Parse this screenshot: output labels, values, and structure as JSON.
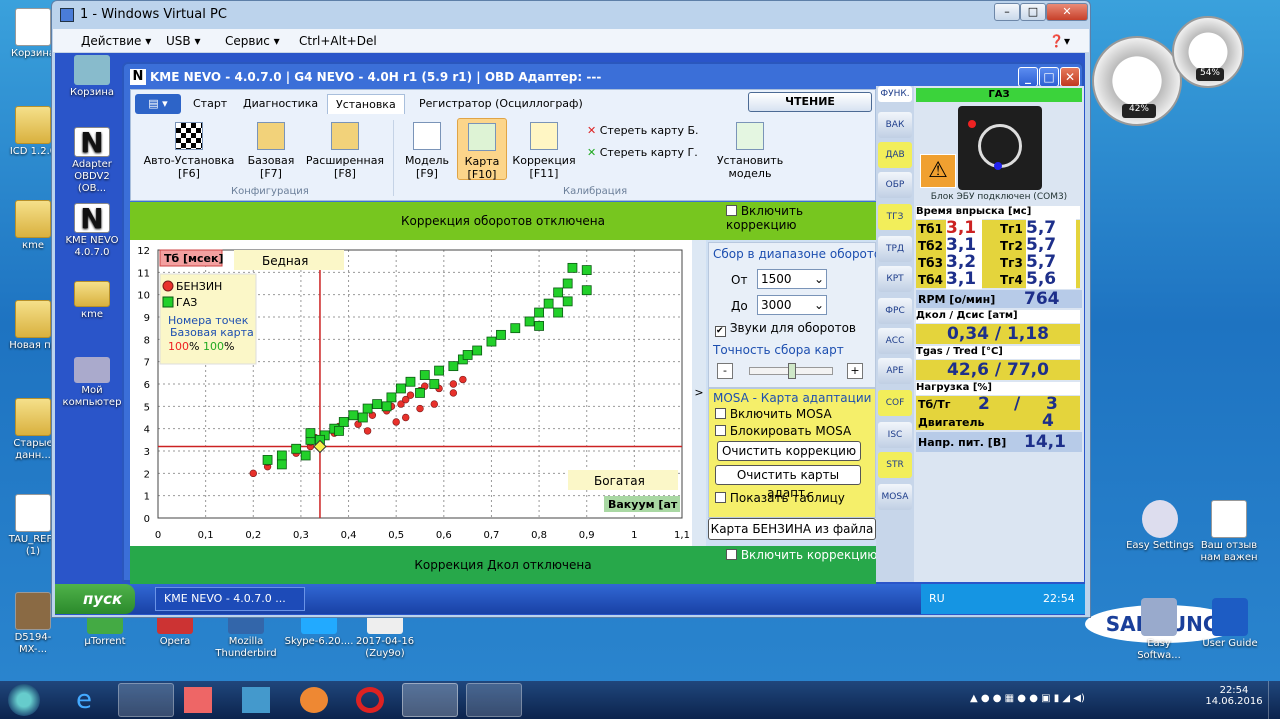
{
  "host_desktop": {
    "icons": [
      "Корзина",
      "ICD 1.2.0",
      "кme",
      "Новая па",
      "Старые данн...",
      "TAU_REF_ (1)",
      "D5194-MX-...",
      "µTorrent",
      "Opera",
      "Mozilla Thunderbird",
      "Skype-6.20....",
      "2017-04-16 (Zuy9o)",
      "Easy Settings",
      "Ваш отзыв нам важен",
      "Easy Softwa...",
      "User Guide"
    ]
  },
  "gadgets": {
    "cpu": "42%",
    "mem": "54%"
  },
  "vpc": {
    "title": "1 - Windows Virtual PC",
    "menu": [
      "Действие ▾",
      "USB ▾",
      "Сервис ▾",
      "Ctrl+Alt+Del"
    ],
    "help": "❓▾"
  },
  "guest_icons": [
    "Корзина",
    "Adapter OBDV2 (OB...",
    "KME NEVO 4.0.7.0",
    "кme",
    "Мой компьютер"
  ],
  "kme": {
    "title": "KME NEVO - 4.0.7.0  |  G4 NEVO - 4.0H r1 (5.9 r1)  |  OBD Адаптер: ---",
    "tabs": [
      "Старт",
      "Диагностика",
      "Установка",
      "Регистратор (Осциллограф)"
    ],
    "read_button": "ЧТЕНИЕ",
    "config_buttons": [
      {
        "l1": "Авто-Установка",
        "l2": "[F6]"
      },
      {
        "l1": "Базовая",
        "l2": "[F7]"
      },
      {
        "l1": "Расширенная",
        "l2": "[F8]"
      }
    ],
    "calib_buttons": [
      {
        "l1": "Модель",
        "l2": "[F9]"
      },
      {
        "l1": "Карта",
        "l2": "[F10]"
      },
      {
        "l1": "Коррекция",
        "l2": "[F11]"
      }
    ],
    "erase_b": "Стереть карту Б.",
    "erase_g": "Стереть карту Г.",
    "set_model": "Установить модель",
    "group_config": "Конфигурация",
    "group_calib": "Калибрация",
    "rpm_corr": "Коррекция оборотов отключена",
    "rpm_corr_cb": "Включить коррекцию",
    "pcol_corr": "Коррекция Дкол отключена",
    "pcol_corr_cb": "Включить коррекцию Д",
    "collect_title": "Сбор в диапазоне оборотов",
    "from_label": "От",
    "from_val": "1500",
    "to_label": "До",
    "to_val": "3000",
    "sounds": "Звуки для оборотов",
    "accuracy": "Точность сбора карт",
    "mosa_title": "MOSA - Карта адаптации",
    "mosa_enable": "Включить MOSA",
    "mosa_block": "Блокировать MOSA",
    "clear_corr": "Очистить коррекцию",
    "clear_maps": "Очистить карты адапт.",
    "show_table": "Показать таблицу",
    "load_map": "Карта БЕНЗИНА из файла"
  },
  "chart_data": {
    "type": "scatter",
    "ylabel_box": "Тб [мсек]",
    "xlabel_box": "Вакуум [ат",
    "lean": "Бедная",
    "rich": "Богатая",
    "legend": [
      "БЕНЗИН",
      "ГАЗ"
    ],
    "legend_note1": "Номера точек",
    "legend_note2": "Базовая карта",
    "pct_red": "100",
    "pct_green": "100",
    "xlim": [
      0,
      1.1
    ],
    "ylim": [
      0,
      12
    ],
    "xticks": [
      "0",
      "0,1",
      "0,2",
      "0,3",
      "0,4",
      "0,5",
      "0,6",
      "0,7",
      "0,8",
      "0,9",
      "1",
      "1,1"
    ],
    "yticks": [
      "0",
      "1",
      "2",
      "3",
      "4",
      "5",
      "6",
      "7",
      "8",
      "9",
      "10",
      "11",
      "12"
    ],
    "crosshair": {
      "x": 0.34,
      "y": 3.2
    },
    "series": [
      {
        "name": "БЕНЗИН",
        "color": "#e8312b",
        "points": [
          [
            0.2,
            2.0
          ],
          [
            0.23,
            2.3
          ],
          [
            0.23,
            2.5
          ],
          [
            0.26,
            2.6
          ],
          [
            0.26,
            2.8
          ],
          [
            0.29,
            2.9
          ],
          [
            0.29,
            3.1
          ],
          [
            0.32,
            3.2
          ],
          [
            0.32,
            3.4
          ],
          [
            0.33,
            3.6
          ],
          [
            0.35,
            3.7
          ],
          [
            0.37,
            3.8
          ],
          [
            0.38,
            4.1
          ],
          [
            0.39,
            4.3
          ],
          [
            0.42,
            4.2
          ],
          [
            0.43,
            4.5
          ],
          [
            0.45,
            4.6
          ],
          [
            0.48,
            4.8
          ],
          [
            0.49,
            5.0
          ],
          [
            0.51,
            5.1
          ],
          [
            0.52,
            5.3
          ],
          [
            0.53,
            5.5
          ],
          [
            0.55,
            5.7
          ],
          [
            0.56,
            5.9
          ],
          [
            0.59,
            5.8
          ],
          [
            0.62,
            6.0
          ],
          [
            0.64,
            6.2
          ],
          [
            0.62,
            5.6
          ],
          [
            0.55,
            4.9
          ],
          [
            0.58,
            5.1
          ],
          [
            0.5,
            4.3
          ],
          [
            0.52,
            4.5
          ],
          [
            0.44,
            3.9
          ]
        ]
      },
      {
        "name": "ГАЗ",
        "color": "#22d02a",
        "points": [
          [
            0.23,
            2.6
          ],
          [
            0.26,
            2.8
          ],
          [
            0.29,
            3.1
          ],
          [
            0.32,
            3.5
          ],
          [
            0.32,
            3.8
          ],
          [
            0.35,
            3.7
          ],
          [
            0.37,
            4.0
          ],
          [
            0.39,
            4.3
          ],
          [
            0.41,
            4.6
          ],
          [
            0.44,
            4.9
          ],
          [
            0.46,
            5.1
          ],
          [
            0.49,
            5.4
          ],
          [
            0.51,
            5.8
          ],
          [
            0.53,
            6.1
          ],
          [
            0.56,
            6.4
          ],
          [
            0.59,
            6.6
          ],
          [
            0.62,
            6.8
          ],
          [
            0.64,
            7.1
          ],
          [
            0.67,
            7.5
          ],
          [
            0.7,
            7.9
          ],
          [
            0.72,
            8.2
          ],
          [
            0.75,
            8.5
          ],
          [
            0.78,
            8.8
          ],
          [
            0.8,
            9.2
          ],
          [
            0.82,
            9.6
          ],
          [
            0.84,
            10.1
          ],
          [
            0.86,
            10.5
          ],
          [
            0.87,
            11.2
          ],
          [
            0.9,
            11.1
          ],
          [
            0.9,
            10.2
          ],
          [
            0.86,
            9.7
          ],
          [
            0.84,
            9.2
          ],
          [
            0.8,
            8.6
          ],
          [
            0.65,
            7.3
          ],
          [
            0.58,
            6.0
          ],
          [
            0.55,
            5.6
          ],
          [
            0.48,
            5.0
          ],
          [
            0.43,
            4.5
          ],
          [
            0.38,
            3.9
          ],
          [
            0.34,
            3.5
          ],
          [
            0.26,
            2.4
          ],
          [
            0.31,
            2.8
          ]
        ]
      }
    ]
  },
  "side_buttons": [
    "ФУНК.",
    "ВАК",
    "ДАВ",
    "ОБР",
    "ТГЗ",
    "ТРД",
    "КРТ",
    "ФРС",
    "АСС",
    "АРЕ",
    "COF",
    "ISC",
    "STR",
    "MOSA"
  ],
  "status": {
    "fuel": "ГАЗ",
    "ecu": "Блок ЭБУ подключен (COM3)",
    "inj_title": "Время впрыска [мс]",
    "inj": [
      {
        "b": "Тб1",
        "bv": "3,1",
        "g": "Тг1",
        "gv": "5,7"
      },
      {
        "b": "Тб2",
        "bv": "3,1",
        "g": "Тг2",
        "gv": "5,7"
      },
      {
        "b": "Тб3",
        "bv": "3,2",
        "g": "Тг3",
        "gv": "5,7"
      },
      {
        "b": "Тб4",
        "bv": "3,1",
        "g": "Тг4",
        "gv": "5,6"
      }
    ],
    "rpm_label": "RPM [о/мин]",
    "rpm": "764",
    "press_title": "Дкол / Дсис [атм]",
    "press": "0,34 / 1,18",
    "temp_title": "Tgas / Tred [°C]",
    "temp": "42,6 / 77,0",
    "load_title": "Нагрузка [%]",
    "load_tb_label": "Тб/Тг",
    "load_tb": "2",
    "load_slash": "/",
    "load_tg": "3",
    "engine_label": "Двигатель",
    "engine": "4",
    "volt_label": "Напр. пит. [В]",
    "volt": "14,1"
  },
  "guest_taskbar": {
    "start": "пуск",
    "task": "KME NEVO - 4.0.7.0 ...",
    "lang": "RU",
    "time": "22:54"
  },
  "host_taskbar": {
    "time": "22:54",
    "date": "14.06.2016"
  }
}
